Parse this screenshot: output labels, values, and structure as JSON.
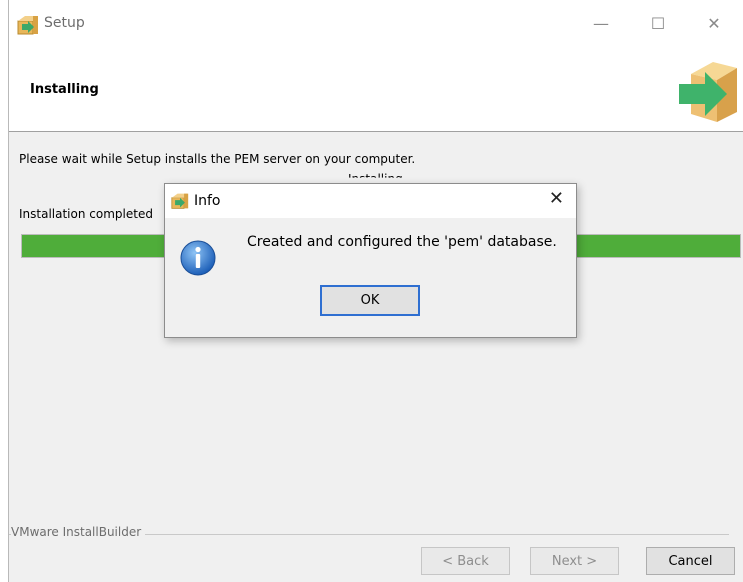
{
  "window": {
    "title": "Setup",
    "controls": {
      "minimize": "—",
      "maximize": "☐",
      "close": "✕"
    }
  },
  "header": {
    "title": "Installing",
    "icon": "installer-arrow-box-icon"
  },
  "main": {
    "description": "Please wait while Setup installs the PEM server on your computer.",
    "stray_text": "Installing",
    "status": "Installation completed",
    "progress": 1.0,
    "progress_color": "#4fad3a"
  },
  "footer": {
    "brand": "VMware InstallBuilder",
    "back_label": "< Back",
    "next_label": "Next >",
    "cancel_label": "Cancel"
  },
  "dialog": {
    "title": "Info",
    "close": "✕",
    "message": "Created and configured the 'pem' database.",
    "icon": "info-icon",
    "ok_label": "OK",
    "accent": "#2f6fd1"
  }
}
